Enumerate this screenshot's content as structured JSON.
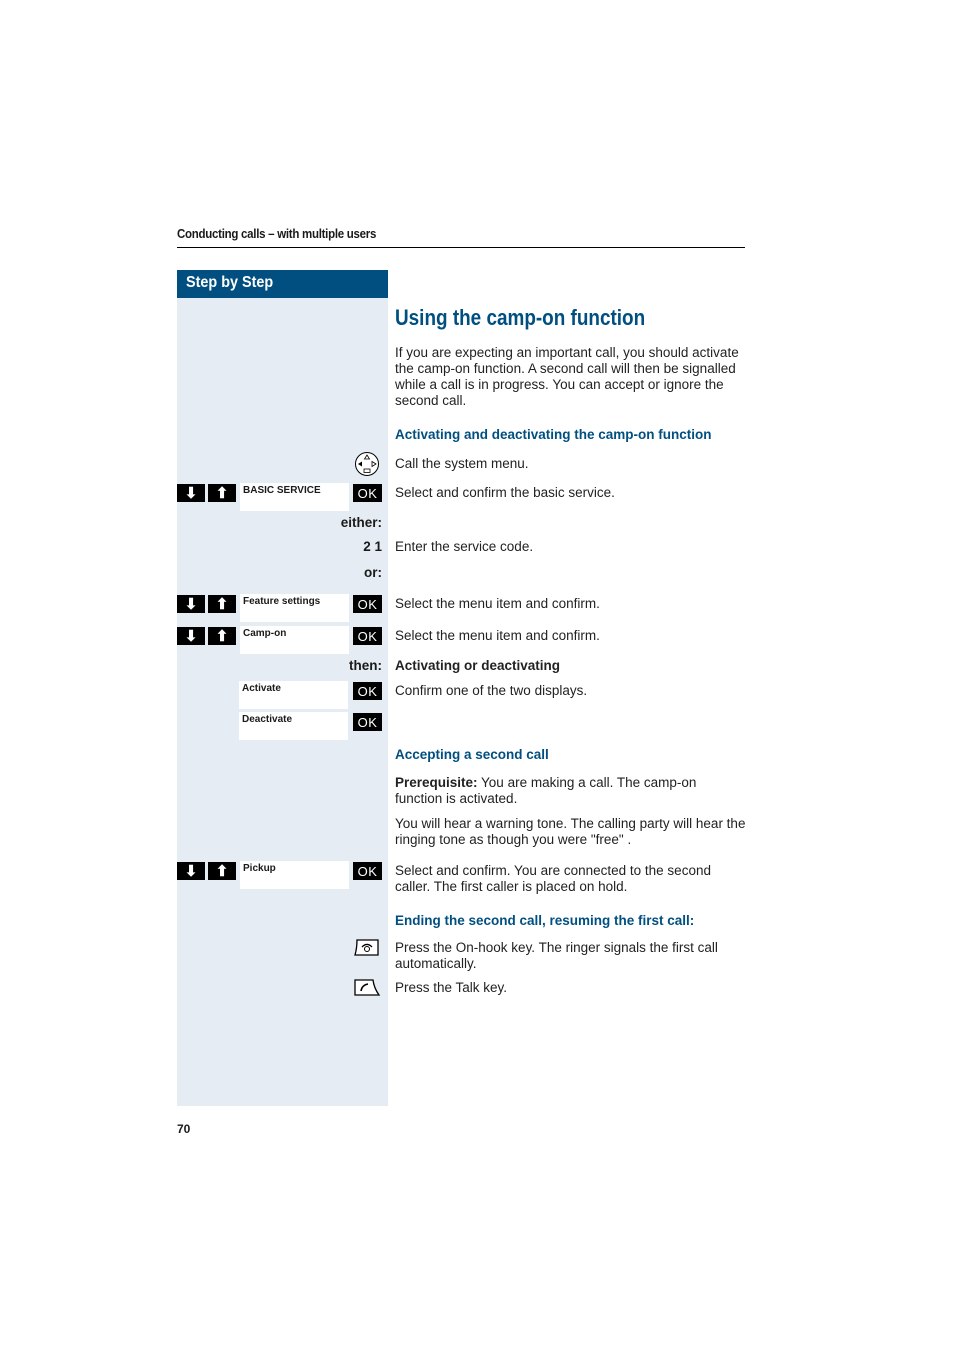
{
  "header": {
    "running_title": "Conducting calls – with multiple users",
    "sidebar_title": "Step by Step"
  },
  "main": {
    "title": "Using the camp-on function",
    "intro": "If you are expecting an important call, you should activate the camp-on function. A second call will then be signalled while a call is in progress. You can accept or ignore the second call.",
    "section1": {
      "heading": "Activating and deactivating the camp-on function",
      "steps": [
        {
          "icon": "navigator-key-icon",
          "text": "Call the system menu."
        },
        {
          "display": "BASIC SERVICE",
          "ok": "OK",
          "text": "Select and confirm the basic service."
        },
        {
          "label": "either:"
        },
        {
          "label": "2 1",
          "text": "Enter the service code."
        },
        {
          "label": "or:"
        },
        {
          "display": "Feature settings",
          "ok": "OK",
          "text": "Select the menu item and confirm."
        },
        {
          "display": "Camp-on",
          "ok": "OK",
          "text": "Select the menu item and confirm."
        },
        {
          "label": "then:",
          "text": "Activating or deactivating"
        },
        {
          "display": "Activate",
          "ok": "OK",
          "text": "Confirm one of the two displays."
        },
        {
          "display": "Deactivate",
          "ok": "OK"
        }
      ]
    },
    "section2": {
      "heading": "Accepting a second call",
      "prereq_label": "Prerequisite:",
      "prereq_text": " You are making a call. The camp-on function is activated.",
      "warning_text": "You will hear a warning tone. The calling party will hear the ringing tone as though you were \"free\" .",
      "steps": [
        {
          "display": "Pickup",
          "ok": "OK",
          "text": "Select and confirm. You are connected to the second caller. The first caller is placed on hold."
        }
      ]
    },
    "section3": {
      "heading": "Ending the second call, resuming the first call:",
      "steps": [
        {
          "icon": "on-hook-key-icon",
          "text": "Press the On-hook key. The ringer signals the first call automatically."
        },
        {
          "icon": "talk-key-icon",
          "text": "Press the Talk key."
        }
      ]
    }
  },
  "buttons": {
    "down": "⬇",
    "up": "⬆"
  },
  "footer": {
    "page_number": "70"
  }
}
